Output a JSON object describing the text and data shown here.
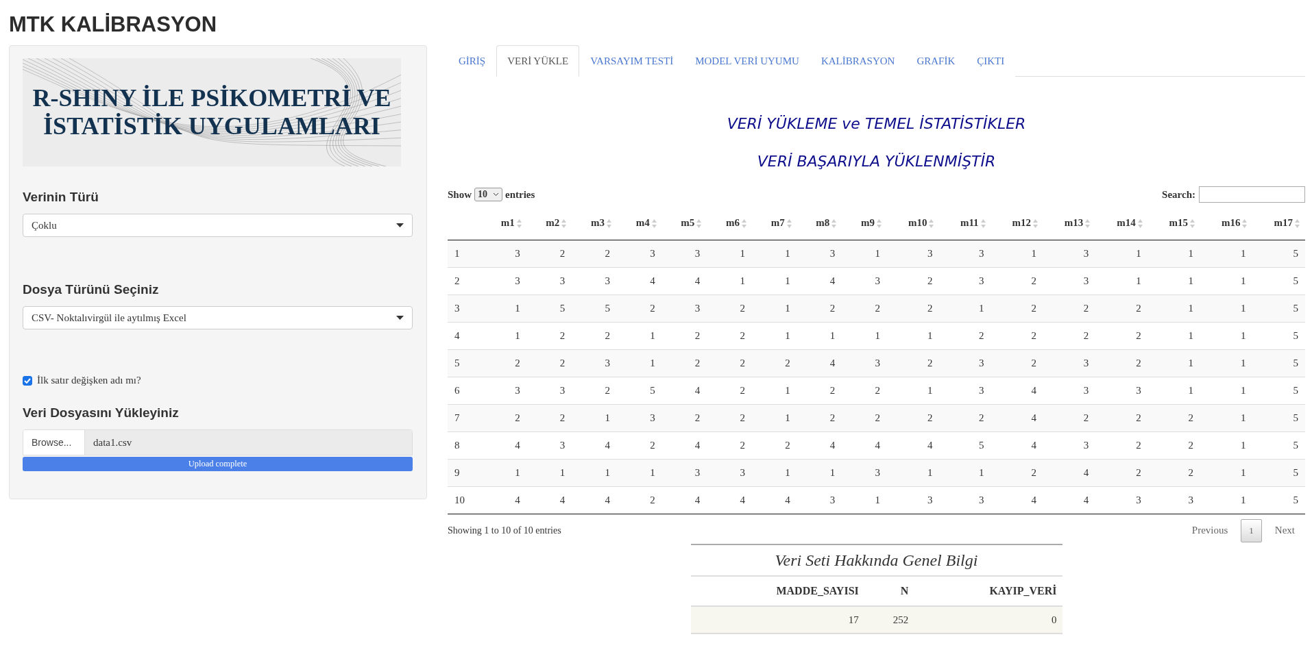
{
  "app_title": "MTK KALİBRASYON",
  "sidebar": {
    "banner": {
      "lines": [
        "R-SHINY İLE PSİKOMETRİ VE",
        "İSTATİSTİK UYGULAMLARI"
      ]
    },
    "fields": [
      {
        "kind": "select",
        "label": "Verinin Türü",
        "value": "Çoklu"
      },
      {
        "kind": "select",
        "label": "Dosya Türünü Seçiniz",
        "value": "CSV- Noktalıvirgül ile aytılmış Excel"
      },
      {
        "kind": "checkbox",
        "label": "İlk satır değişken adı mı?",
        "checked": true
      },
      {
        "kind": "file",
        "label": "Veri Dosyasını Yükleyiniz",
        "button": "Browse...",
        "filename": "data1.csv",
        "progress": {
          "text": "Upload complete",
          "level": 1
        }
      }
    ]
  },
  "tabs": [
    {
      "label": "GİRİŞ",
      "selected": false
    },
    {
      "label": "VERİ YÜKLE",
      "selected": true
    },
    {
      "label": "VARSAYIM TESTİ",
      "selected": false
    },
    {
      "label": "MODEL VERİ UYUMU",
      "selected": false
    },
    {
      "label": "KALİBRASYON",
      "selected": false
    },
    {
      "label": "GRAFİK",
      "selected": false
    },
    {
      "label": "ÇIKTI",
      "selected": false
    }
  ],
  "headings": [
    "VERİ YÜKLEME ve TEMEL İSTATİSTİKLER",
    "VERİ BAŞARIYLA YÜKLENMİŞTİR"
  ],
  "table": {
    "show_label": "Show",
    "length_value": "10",
    "entries_label": "entries",
    "search_label": "Search:",
    "columns": [
      "",
      "m1",
      "m2",
      "m3",
      "m4",
      "m5",
      "m6",
      "m7",
      "m8",
      "m9",
      "m10",
      "m11",
      "m12",
      "m13",
      "m14",
      "m15",
      "m16",
      "m17"
    ],
    "rows": [
      [
        "1",
        "3",
        "2",
        "2",
        "3",
        "3",
        "1",
        "1",
        "3",
        "1",
        "3",
        "3",
        "1",
        "3",
        "1",
        "1",
        "1",
        "5"
      ],
      [
        "2",
        "3",
        "3",
        "3",
        "4",
        "4",
        "1",
        "1",
        "4",
        "3",
        "2",
        "3",
        "2",
        "3",
        "1",
        "1",
        "1",
        "5"
      ],
      [
        "3",
        "1",
        "5",
        "5",
        "2",
        "3",
        "2",
        "1",
        "2",
        "2",
        "2",
        "1",
        "2",
        "2",
        "2",
        "1",
        "1",
        "5"
      ],
      [
        "4",
        "1",
        "2",
        "2",
        "1",
        "2",
        "2",
        "1",
        "1",
        "1",
        "1",
        "2",
        "2",
        "2",
        "2",
        "1",
        "1",
        "5"
      ],
      [
        "5",
        "2",
        "2",
        "3",
        "1",
        "2",
        "2",
        "2",
        "4",
        "3",
        "2",
        "3",
        "2",
        "3",
        "2",
        "1",
        "1",
        "5"
      ],
      [
        "6",
        "3",
        "3",
        "2",
        "5",
        "4",
        "2",
        "1",
        "2",
        "2",
        "1",
        "3",
        "4",
        "3",
        "3",
        "1",
        "1",
        "5"
      ],
      [
        "7",
        "2",
        "2",
        "1",
        "3",
        "2",
        "2",
        "1",
        "2",
        "2",
        "2",
        "2",
        "4",
        "2",
        "2",
        "2",
        "1",
        "5"
      ],
      [
        "8",
        "4",
        "3",
        "4",
        "2",
        "4",
        "2",
        "2",
        "4",
        "4",
        "4",
        "5",
        "4",
        "3",
        "2",
        "2",
        "1",
        "5"
      ],
      [
        "9",
        "1",
        "1",
        "1",
        "1",
        "3",
        "3",
        "1",
        "1",
        "3",
        "1",
        "1",
        "2",
        "4",
        "2",
        "2",
        "1",
        "5"
      ],
      [
        "10",
        "4",
        "4",
        "4",
        "2",
        "4",
        "4",
        "4",
        "3",
        "1",
        "3",
        "3",
        "4",
        "4",
        "3",
        "3",
        "1",
        "5"
      ]
    ],
    "info": "Showing 1 to 10 of 10 entries",
    "pagination": [
      {
        "label": "Previous",
        "kind": "nav",
        "selected": false
      },
      {
        "label": "1",
        "kind": "page",
        "selected": true
      },
      {
        "label": "Next",
        "kind": "nav",
        "selected": false
      }
    ]
  },
  "summary": {
    "caption": "Veri Seti Hakkında Genel Bilgi",
    "columns": [
      "MADDE_SAYISI",
      "N",
      "KAYIP_VERİ"
    ],
    "rows": [
      [
        "17",
        "252",
        "0"
      ]
    ]
  }
}
